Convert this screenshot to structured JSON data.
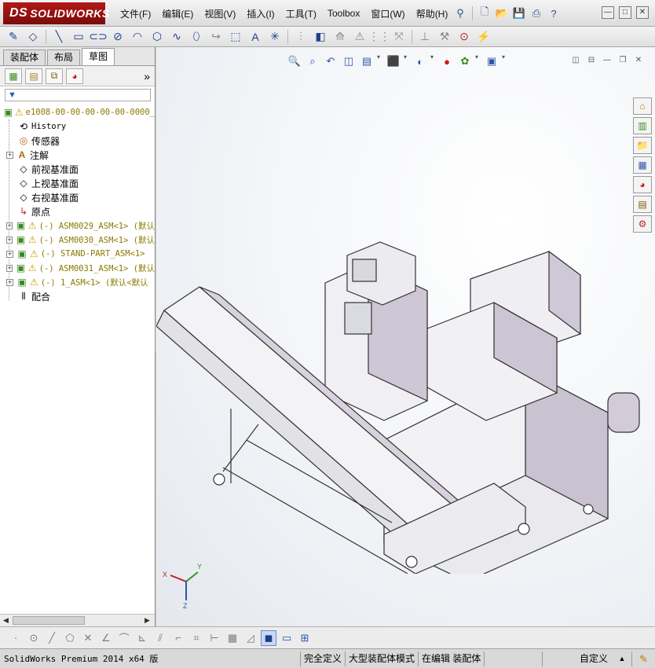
{
  "app": {
    "logo_mark": "DS",
    "logo_text": "SOLIDWORKS"
  },
  "menu": [
    "文件(F)",
    "编辑(E)",
    "视图(V)",
    "插入(I)",
    "工具(T)",
    "Toolbox",
    "窗口(W)",
    "帮助(H)"
  ],
  "window_controls": {
    "minimize": "—",
    "restore": "□",
    "close": "✕"
  },
  "tabs": [
    "装配体",
    "布局",
    "草图"
  ],
  "active_tab": "草图",
  "filter_symbol": "▼",
  "feature_tree": {
    "root": "e1008-00-00-00-00-00-0000_",
    "items": [
      {
        "label": "History",
        "icon": "history-icon"
      },
      {
        "label": "传感器",
        "icon": "sensor-icon"
      },
      {
        "label": "注解",
        "icon": "annotation-icon"
      },
      {
        "label": "前视基准面",
        "icon": "plane-icon"
      },
      {
        "label": "上视基准面",
        "icon": "plane-icon"
      },
      {
        "label": "右视基准面",
        "icon": "plane-icon"
      },
      {
        "label": "原点",
        "icon": "origin-icon"
      },
      {
        "label": "(-) ASM0029_ASM<1> (默认",
        "icon": "subassembly-icon"
      },
      {
        "label": "(-) ASM0030_ASM<1> (默认",
        "icon": "subassembly-icon"
      },
      {
        "label": "(-) STAND-PART_ASM<1>",
        "icon": "subassembly-icon"
      },
      {
        "label": "(-) ASM0031_ASM<1> (默认",
        "icon": "subassembly-icon"
      },
      {
        "label": "(-) 1_ASM<1> (默认<默认",
        "icon": "subassembly-icon"
      },
      {
        "label": "配合",
        "icon": "mates-icon"
      }
    ]
  },
  "triad": {
    "x": "X",
    "y": "Y",
    "z": "Z"
  },
  "status": {
    "product": "SolidWorks Premium 2014 x64 版",
    "definition": "完全定义",
    "mode": "大型装配体模式",
    "editing": "在编辑 装配体",
    "units": "自定义"
  },
  "colors": {
    "logo_red": "#b31717",
    "selection_blue": "#1b3f85",
    "warning": "#d19a00"
  }
}
